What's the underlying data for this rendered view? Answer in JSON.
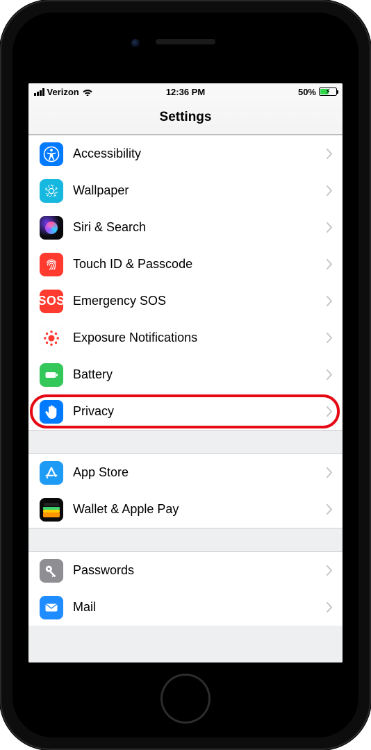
{
  "status": {
    "carrier": "Verizon",
    "time": "12:36 PM",
    "battery_pct": "50%"
  },
  "nav": {
    "title": "Settings"
  },
  "groups": [
    {
      "rows": [
        {
          "icon": "accessibility",
          "label": "Accessibility"
        },
        {
          "icon": "wallpaper",
          "label": "Wallpaper"
        },
        {
          "icon": "siri",
          "label": "Siri & Search"
        },
        {
          "icon": "touchid",
          "label": "Touch ID & Passcode"
        },
        {
          "icon": "sos",
          "label": "Emergency SOS",
          "icon_text": "SOS"
        },
        {
          "icon": "exposure",
          "label": "Exposure Notifications"
        },
        {
          "icon": "battery",
          "label": "Battery"
        },
        {
          "icon": "privacy",
          "label": "Privacy",
          "highlighted": true
        }
      ]
    },
    {
      "rows": [
        {
          "icon": "appstore",
          "label": "App Store"
        },
        {
          "icon": "wallet",
          "label": "Wallet & Apple Pay"
        }
      ]
    },
    {
      "rows": [
        {
          "icon": "passwords",
          "label": "Passwords"
        },
        {
          "icon": "mail",
          "label": "Mail"
        }
      ]
    }
  ]
}
